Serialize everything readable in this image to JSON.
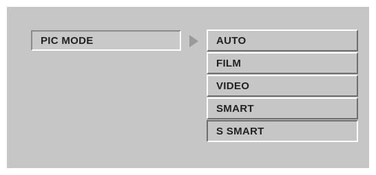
{
  "osd": {
    "setting_label": "PIC MODE",
    "arrow_icon": "triangle-right-icon",
    "options": [
      {
        "label": "AUTO"
      },
      {
        "label": "FILM"
      },
      {
        "label": "VIDEO"
      },
      {
        "label": "SMART"
      },
      {
        "label": "S SMART"
      }
    ],
    "selected_option": "S SMART"
  }
}
